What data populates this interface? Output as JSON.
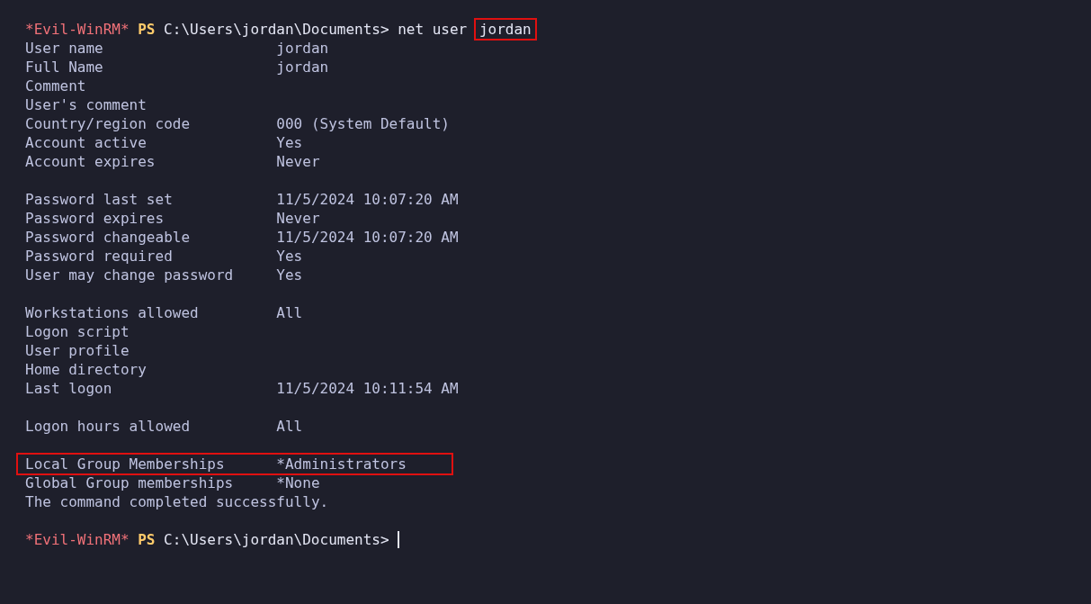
{
  "terminal": {
    "lines": [
      {
        "kind": "prompt",
        "shell": "*Evil-WinRM*",
        "ps": "PS",
        "path": "C:\\Users\\jordan\\Documents>",
        "command": "net user",
        "argument": "jordan",
        "argument_highlighted": true,
        "cursor": false
      },
      {
        "kind": "field",
        "label": "User name",
        "value": "jordan",
        "highlighted": false
      },
      {
        "kind": "field",
        "label": "Full Name",
        "value": "jordan",
        "highlighted": false
      },
      {
        "kind": "field",
        "label": "Comment",
        "highlighted": false
      },
      {
        "kind": "field",
        "label": "User's comment",
        "highlighted": false
      },
      {
        "kind": "field",
        "label": "Country/region code",
        "value": "000 (System Default)",
        "highlighted": false
      },
      {
        "kind": "field",
        "label": "Account active",
        "value": "Yes",
        "highlighted": false
      },
      {
        "kind": "field",
        "label": "Account expires",
        "value": "Never",
        "highlighted": false
      },
      {
        "kind": "blank"
      },
      {
        "kind": "field",
        "label": "Password last set",
        "value": "11/5/2024 10:07:20 AM",
        "highlighted": false
      },
      {
        "kind": "field",
        "label": "Password expires",
        "value": "Never",
        "highlighted": false
      },
      {
        "kind": "field",
        "label": "Password changeable",
        "value": "11/5/2024 10:07:20 AM",
        "highlighted": false
      },
      {
        "kind": "field",
        "label": "Password required",
        "value": "Yes",
        "highlighted": false
      },
      {
        "kind": "field",
        "label": "User may change password",
        "value": "Yes",
        "highlighted": false
      },
      {
        "kind": "blank"
      },
      {
        "kind": "field",
        "label": "Workstations allowed",
        "value": "All",
        "highlighted": false
      },
      {
        "kind": "field",
        "label": "Logon script",
        "highlighted": false
      },
      {
        "kind": "field",
        "label": "User profile",
        "highlighted": false
      },
      {
        "kind": "field",
        "label": "Home directory",
        "highlighted": false
      },
      {
        "kind": "field",
        "label": "Last logon",
        "value": "11/5/2024 10:11:54 AM",
        "highlighted": false
      },
      {
        "kind": "blank"
      },
      {
        "kind": "field",
        "label": "Logon hours allowed",
        "value": "All",
        "highlighted": false
      },
      {
        "kind": "blank"
      },
      {
        "kind": "field",
        "label": "Local Group Memberships",
        "value": "*Administrators",
        "highlighted": true
      },
      {
        "kind": "field",
        "label": "Global Group memberships",
        "value": "*None",
        "highlighted": false
      },
      {
        "kind": "text",
        "text": "The command completed successfully."
      },
      {
        "kind": "blank"
      },
      {
        "kind": "prompt",
        "shell": "*Evil-WinRM*",
        "ps": "PS",
        "path": "C:\\Users\\jordan\\Documents>",
        "cursor": true
      }
    ]
  }
}
